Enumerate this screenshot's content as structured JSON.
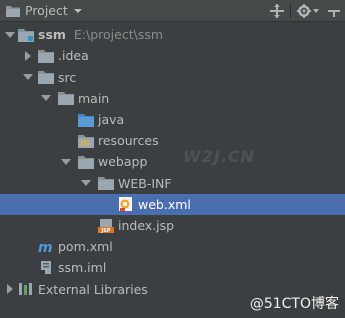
{
  "header": {
    "title": "Project"
  },
  "tree": {
    "root_label": "ssm",
    "root_path": "E:\\project\\ssm",
    "idea": ".idea",
    "src": "src",
    "main": "main",
    "java": "java",
    "resources": "resources",
    "webapp": "webapp",
    "webinf": "WEB-INF",
    "webxml": "web.xml",
    "indexjsp": "index.jsp",
    "pomxml": "pom.xml",
    "ssmiml": "ssm.iml",
    "extlibs": "External Libraries"
  },
  "watermark_mid": "W2J.CN",
  "watermark": "@51CTO博客",
  "colors": {
    "background": "#3c3f41",
    "selection": "#4b6eaf",
    "folder": "#87939a",
    "source_folder": "#5b9bd5",
    "text": "#bbbbbb"
  }
}
